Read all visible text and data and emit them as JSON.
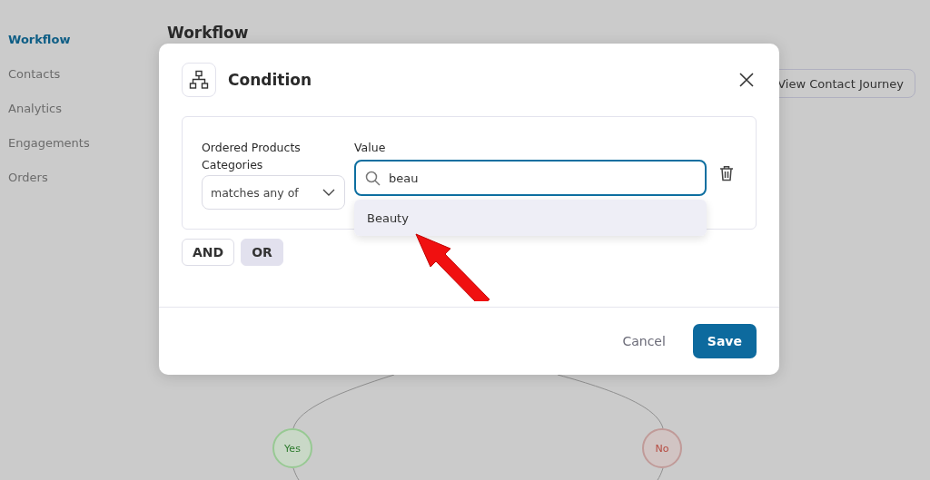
{
  "sidebar": {
    "items": [
      {
        "label": "Workflow",
        "selected": true
      },
      {
        "label": "Contacts",
        "selected": false
      },
      {
        "label": "Analytics",
        "selected": false
      },
      {
        "label": "Engagements",
        "selected": false
      },
      {
        "label": "Orders",
        "selected": false
      }
    ]
  },
  "page_title": "Workflow",
  "journey_button": "View Contact Journey",
  "branches": [
    {
      "label": "Yes",
      "kind": "yes"
    },
    {
      "label": "No",
      "kind": "no"
    }
  ],
  "modal": {
    "title": "Condition",
    "field_label": "Ordered Products Categories",
    "operator": "matches any of",
    "value_label": "Value",
    "search_value": "beau",
    "suggestions": [
      {
        "label": "Beauty",
        "highlighted": true
      }
    ],
    "logic": [
      {
        "label": "AND",
        "selected": false
      },
      {
        "label": "OR",
        "selected": true
      }
    ],
    "cancel": "Cancel",
    "save": "Save"
  }
}
